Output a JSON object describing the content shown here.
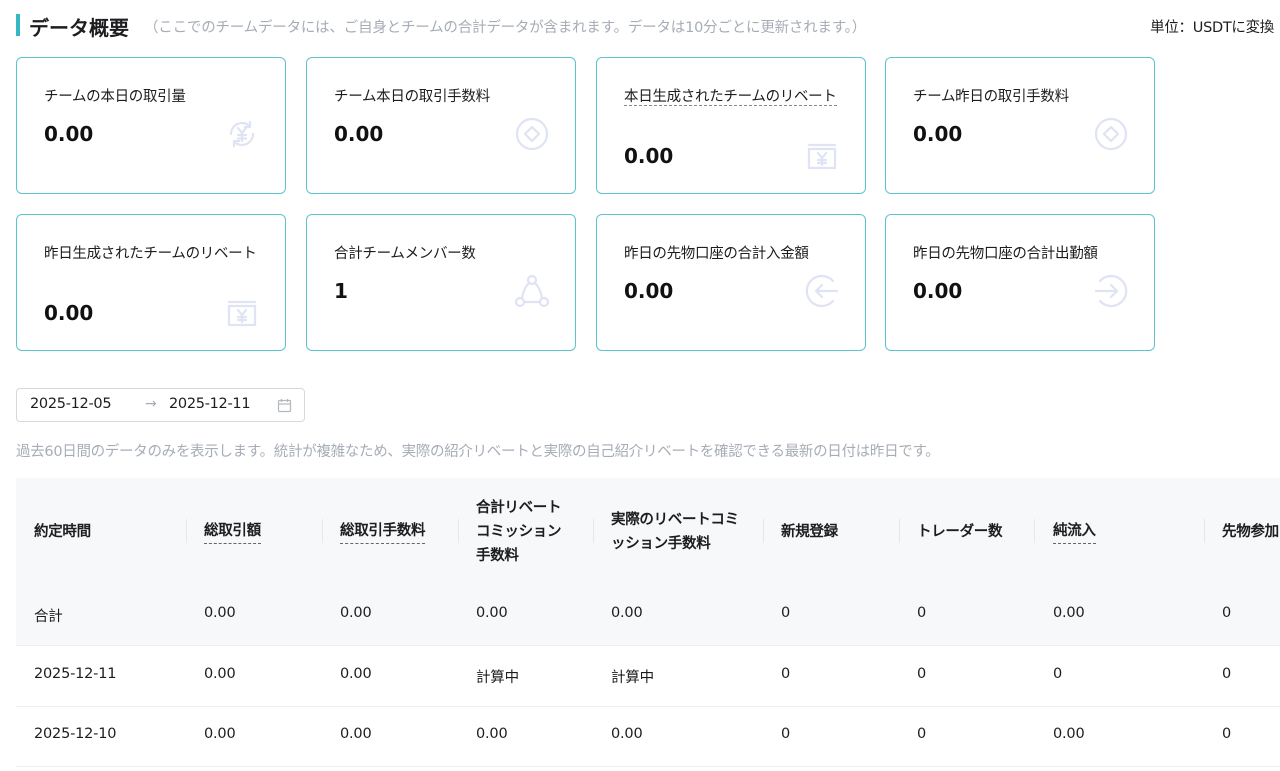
{
  "header": {
    "title": "データ概要",
    "note": "（ここでのチームデータには、ご自身とチームの合計データが含まれます。データは10分ごとに更新されます。）",
    "unit": "単位：USDTに変換"
  },
  "cards": [
    {
      "label": "チームの本日の取引量",
      "value": "0.00",
      "icon": "yen-exchange-icon"
    },
    {
      "label": "チーム本日の取引手数料",
      "value": "0.00",
      "icon": "diamond-coin-icon"
    },
    {
      "label": "本日生成されたチームのリベート",
      "value": "0.00",
      "icon": "yen-box-icon"
    },
    {
      "label": "チーム昨日の取引手数料",
      "value": "0.00",
      "icon": "diamond-coin-icon"
    },
    {
      "label": "昨日生成されたチームのリベート",
      "value": "0.00",
      "icon": "yen-box-icon"
    },
    {
      "label": "合計チームメンバー数",
      "value": "1",
      "icon": "team-nodes-icon"
    },
    {
      "label": "昨日の先物口座の合計入金額",
      "value": "0.00",
      "icon": "arrow-in-icon"
    },
    {
      "label": "昨日の先物口座の合計出勤額",
      "value": "0.00",
      "icon": "arrow-out-icon"
    }
  ],
  "date_range": {
    "start": "2025-12-05",
    "arrow": "→",
    "end": "2025-12-11"
  },
  "notice": "過去60日間のデータのみを表示します。統計が複雑なため、実際の紹介リベートと実際の自己紹介リベートを確認できる最新の日付は昨日です。",
  "table": {
    "columns": [
      "約定時間",
      "総取引額",
      "総取引手数料",
      "合計リベートコミッション手数料",
      "実際のリベートコミッション手数料",
      "新規登録",
      "トレーダー数",
      "純流入",
      "先物参加"
    ],
    "rows": [
      [
        "合計",
        "0.00",
        "0.00",
        "0.00",
        "0.00",
        "0",
        "0",
        "0.00",
        "0"
      ],
      [
        "2025-12-11",
        "0.00",
        "0.00",
        "計算中",
        "計算中",
        "0",
        "0",
        "0",
        "0"
      ],
      [
        "2025-12-10",
        "0.00",
        "0.00",
        "0.00",
        "0.00",
        "0",
        "0",
        "0.00",
        "0"
      ]
    ]
  },
  "colors": {
    "accent": "#35b7c4",
    "card_border": "#5cc4cd",
    "icon": "#dfe3f3",
    "muted_text": "#a7adb6"
  }
}
